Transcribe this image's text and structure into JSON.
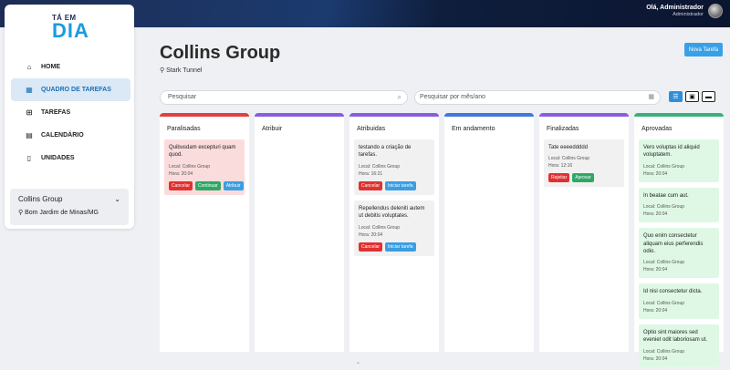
{
  "header": {
    "user_name": "Olá, Administrador",
    "user_role": "Administrador"
  },
  "logo": {
    "top": "TÁ EM",
    "main": "DIA"
  },
  "sidebar": {
    "items": [
      {
        "label": "HOME",
        "icon": "⌂",
        "active": false
      },
      {
        "label": "QUADRO DE TAREFAS",
        "icon": "▦",
        "active": true
      },
      {
        "label": "TAREFAS",
        "icon": "⊞",
        "active": false
      },
      {
        "label": "CALENDÁRIO",
        "icon": "▤",
        "active": false
      },
      {
        "label": "UNIDADES",
        "icon": "▯",
        "active": false
      }
    ],
    "company": {
      "name": "Collins Group",
      "location": "Bom Jardim de Minas/MG"
    }
  },
  "page": {
    "title": "Collins Group",
    "subtitle": "Stark Tunnel",
    "new_task": "Nova Tarefa"
  },
  "search": {
    "placeholder": "Pesquisar"
  },
  "month": {
    "placeholder": "Pesquisar por mês/ano"
  },
  "colors": {
    "red": "#e04040",
    "purple": "#8a5ce0",
    "blue": "#3f78e0",
    "green": "#3bb07a"
  },
  "columns": [
    {
      "title": "Paralisadas",
      "color": "#e04040",
      "cards": [
        {
          "title": "Quibusdam excepturi quam quod.",
          "local": "Local: Collins Group",
          "hora": "Hora: 20:04",
          "bg": "#fbdcdc",
          "actions": [
            {
              "label": "Cancelar",
              "c": "c-red"
            },
            {
              "label": "Continuar",
              "c": "c-green"
            },
            {
              "label": "Atribuir",
              "c": "c-blue"
            }
          ]
        }
      ]
    },
    {
      "title": "Atribuir",
      "color": "#8a5ce0",
      "cards": []
    },
    {
      "title": "Atribuidas",
      "color": "#8a5ce0",
      "cards": [
        {
          "title": "testando a criação de tarefas.",
          "local": "Local: Collins Group",
          "hora": "Hora: 16:21",
          "bg": "#f1f1f1",
          "actions": [
            {
              "label": "Cancelar",
              "c": "c-red"
            },
            {
              "label": "Iniciar tarefa",
              "c": "c-blue"
            }
          ]
        },
        {
          "title": "Repellendus deleniti autem ut debitis voluptates.",
          "local": "Local: Collins Group",
          "hora": "Hora: 20:04",
          "bg": "#f1f1f1",
          "actions": [
            {
              "label": "Cancelar",
              "c": "c-red"
            },
            {
              "label": "Iniciar tarefa",
              "c": "c-blue"
            }
          ]
        }
      ]
    },
    {
      "title": "Em andamento",
      "color": "#3f78e0",
      "cards": []
    },
    {
      "title": "Finalizadas",
      "color": "#8a5ce0",
      "cards": [
        {
          "title": "Tate eeeeddddd",
          "local": "Local: Collins Group",
          "hora": "Hora: 12:16",
          "bg": "#f1f1f1",
          "actions": [
            {
              "label": "Rejeitar",
              "c": "c-red"
            },
            {
              "label": "Aprovar",
              "c": "c-green"
            }
          ]
        }
      ]
    },
    {
      "title": "Aprovadas",
      "color": "#3bb07a",
      "cards": [
        {
          "title": "Vero voluptas id aliquid voluptatem.",
          "local": "Local: Collins Group",
          "hora": "Hora: 20:04",
          "bg": "#dff8e5",
          "actions": []
        },
        {
          "title": "In beatae cum aut.",
          "local": "Local: Collins Group",
          "hora": "Hora: 20:04",
          "bg": "#dff8e5",
          "actions": []
        },
        {
          "title": "Quo enim consectetur aliquam eius perferendis odio.",
          "local": "Local: Collins Group",
          "hora": "Hora: 20:04",
          "bg": "#dff8e5",
          "actions": []
        },
        {
          "title": "Id nisi consectetur dicta.",
          "local": "Local: Collins Group",
          "hora": "Hora: 20:04",
          "bg": "#dff8e5",
          "actions": []
        },
        {
          "title": "Optio sint maiores sed eveniet odit laboriosam ut.",
          "local": "Local: Collins Group",
          "hora": "Hora: 20:04",
          "bg": "#dff8e5",
          "actions": []
        }
      ]
    }
  ]
}
